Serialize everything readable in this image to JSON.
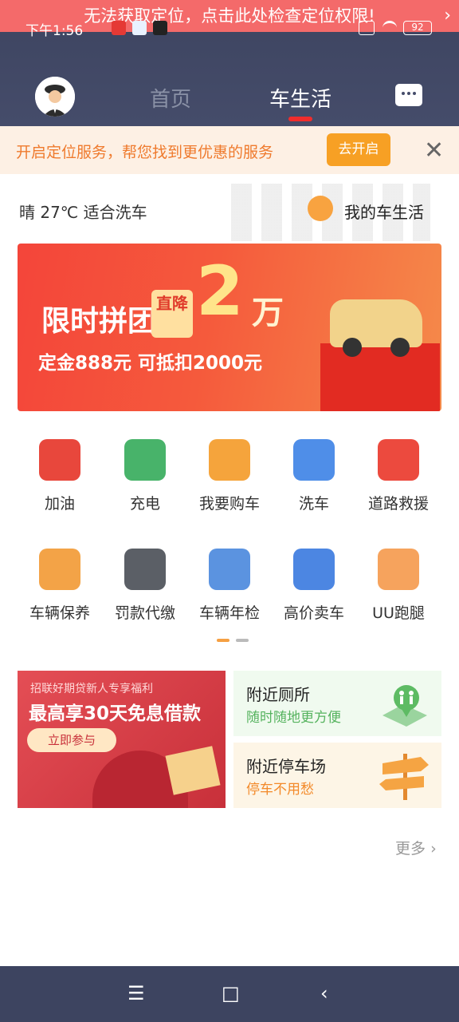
{
  "warning": {
    "text": "无法获取定位，点击此处检查定位权限!",
    "chevron": "›"
  },
  "status_bar": {
    "time": "下午1:56",
    "battery": "92"
  },
  "header": {
    "tabs": [
      {
        "label": "首页"
      },
      {
        "label": "车生活"
      }
    ],
    "active_tab": "车生活"
  },
  "location_bar": {
    "text": "开启定位服务，帮您找到更优惠的服务",
    "button": "去开启",
    "close": "✕"
  },
  "weather": {
    "text": "晴 27℃  适合洗车"
  },
  "my_car_life": {
    "label": "我的车生活"
  },
  "banner": {
    "title": "限时拼团",
    "badge": "直降",
    "amount": "2",
    "unit": "万",
    "sub": "定金888元 可抵扣2000元"
  },
  "services": [
    {
      "label": "加油",
      "icon": "fuel-pump-icon",
      "color": "#e8473c"
    },
    {
      "label": "充电",
      "icon": "charging-pump-icon",
      "color": "#48b36a"
    },
    {
      "label": "我要购车",
      "icon": "gift-car-icon",
      "color": "#f5a43c"
    },
    {
      "label": "洗车",
      "icon": "car-wash-icon",
      "color": "#4f8ee8"
    },
    {
      "label": "道路救援",
      "icon": "traffic-cone-icon",
      "color": "#ec4a3e"
    },
    {
      "label": "车辆保养",
      "icon": "oil-can-icon",
      "color": "#f3a347"
    },
    {
      "label": "罚款代缴",
      "icon": "fine-ticket-icon",
      "color": "#5b5f66"
    },
    {
      "label": "车辆年检",
      "icon": "inspection-clipboard-icon",
      "color": "#5b93e0"
    },
    {
      "label": "高价卖车",
      "icon": "sell-car-icon",
      "color": "#4c86e2"
    },
    {
      "label": "UU跑腿",
      "icon": "uu-errand-icon",
      "color": "#f6a35d"
    }
  ],
  "promo": {
    "subtitle": "招联好期贷新人专享福利",
    "title": "最高享30天免息借款",
    "button": "立即参与"
  },
  "cards": [
    {
      "title": "附近厕所",
      "subtitle": "随时随地更方便"
    },
    {
      "title": "附近停车场",
      "subtitle": "停车不用愁"
    }
  ],
  "more": "更多",
  "nav_bar": {
    "menu": "☰",
    "home": "□",
    "back": "‹"
  }
}
